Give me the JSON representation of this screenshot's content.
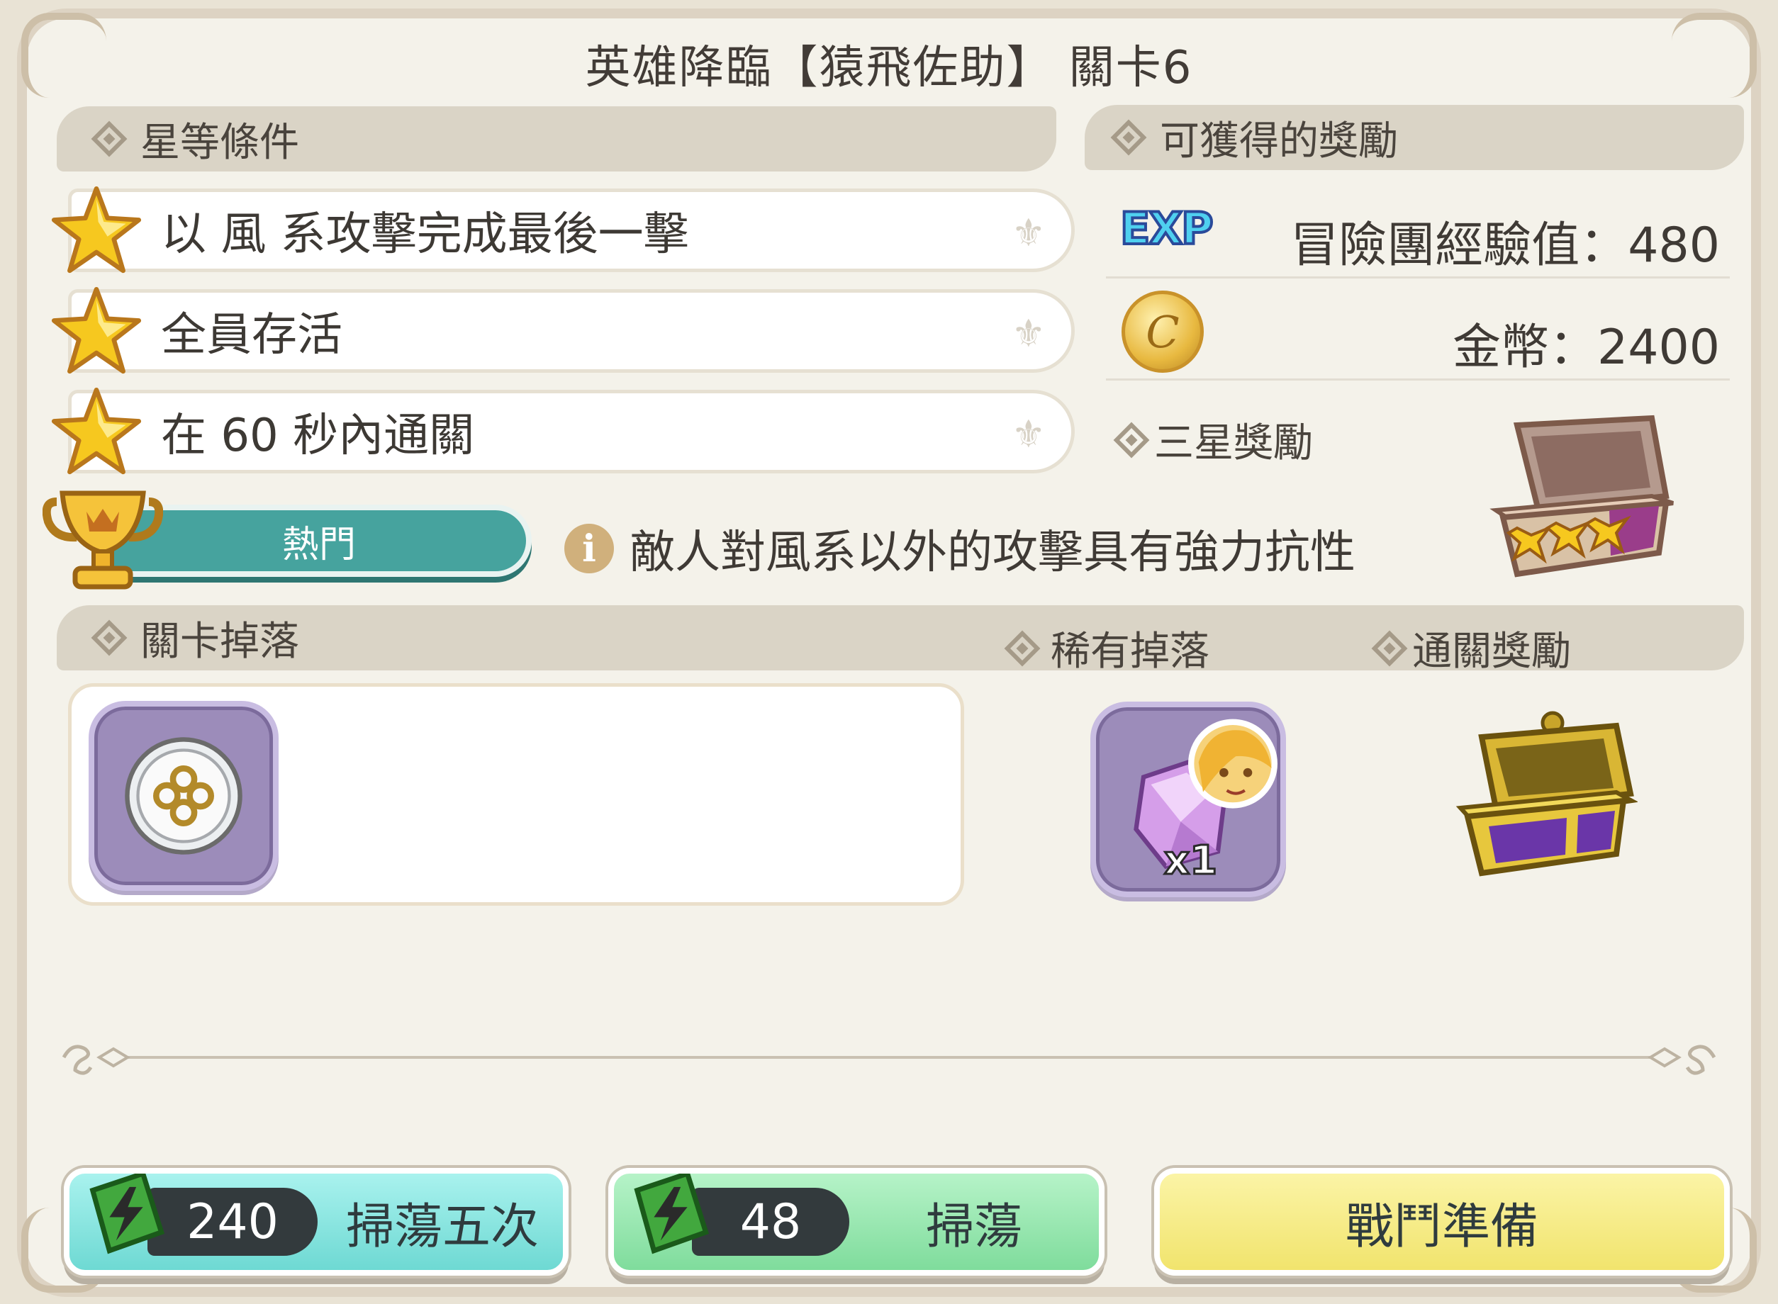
{
  "stage": {
    "title": "英雄降臨【猿飛佐助】 關卡6"
  },
  "star_conditions": {
    "header": "星等條件",
    "items": [
      {
        "label": "以 風 系攻擊完成最後一擊"
      },
      {
        "label": "全員存活"
      },
      {
        "label": "在 60 秒內通關"
      }
    ]
  },
  "rewards": {
    "header": "可獲得的獎勵",
    "exp_icon": "EXP",
    "exp_label": "冒險團經驗值：480",
    "coin_icon": "C",
    "coin_label": "金幣：2400",
    "three_star_label": "三星獎勵"
  },
  "hot": {
    "label": "熱門"
  },
  "info": {
    "icon": "i",
    "text": "敵人對風系以外的攻擊具有強力抗性"
  },
  "drops": {
    "stage_drop_header": "關卡掉落",
    "rare_drop_header": "稀有掉落",
    "clear_reward_header": "通關獎勵",
    "rare_item_count": "x1"
  },
  "buttons": {
    "sweep_five": {
      "cost": "240",
      "label": "掃蕩五次"
    },
    "sweep": {
      "cost": "48",
      "label": "掃蕩"
    },
    "battle": {
      "label": "戰鬥準備"
    }
  },
  "colors": {
    "panel_bg": "#f4f2ea",
    "teal_hot": "#46a39e",
    "sweep_five_bg": "#7fe5e0",
    "sweep_bg": "#8fe6ac",
    "battle_bg": "#f7ee8a",
    "item_frame": "#9c8cba"
  }
}
